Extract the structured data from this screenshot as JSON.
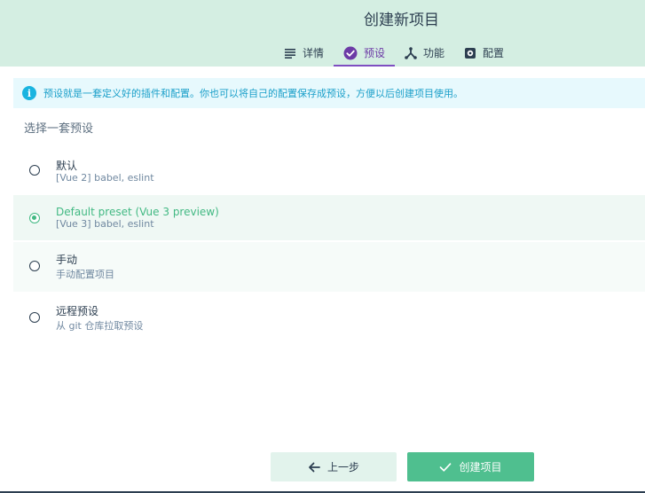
{
  "header": {
    "title": "创建新项目",
    "tabs": [
      {
        "label": "详情",
        "icon": "details-list-icon",
        "active": false
      },
      {
        "label": "预设",
        "icon": "check-circle-icon",
        "active": true
      },
      {
        "label": "功能",
        "icon": "features-branch-icon",
        "active": false
      },
      {
        "label": "配置",
        "icon": "gear-icon",
        "active": false
      }
    ]
  },
  "info": {
    "icon": "info-icon",
    "text": "预设就是一套定义好的插件和配置。你也可以将自己的配置保存成预设，方便以后创建项目使用。"
  },
  "section_title": "选择一套预设",
  "presets": [
    {
      "name": "默认",
      "desc": "[Vue 2] babel, eslint",
      "selected": false
    },
    {
      "name": "Default preset (Vue 3 preview)",
      "desc": "[Vue 3] babel, eslint",
      "selected": true
    },
    {
      "name": "手动",
      "desc": "手动配置项目",
      "selected": false
    },
    {
      "name": "远程预设",
      "desc": "从 git 仓库拉取预设",
      "selected": false
    }
  ],
  "footer": {
    "prev_label": "上一步",
    "create_label": "创建项目"
  },
  "colors": {
    "header_bg": "#d4eee2",
    "accent_green": "#42b983",
    "tab_active": "#6c3aa6",
    "info_bg": "#e7f9fd",
    "info_text": "#1a9fc9"
  }
}
